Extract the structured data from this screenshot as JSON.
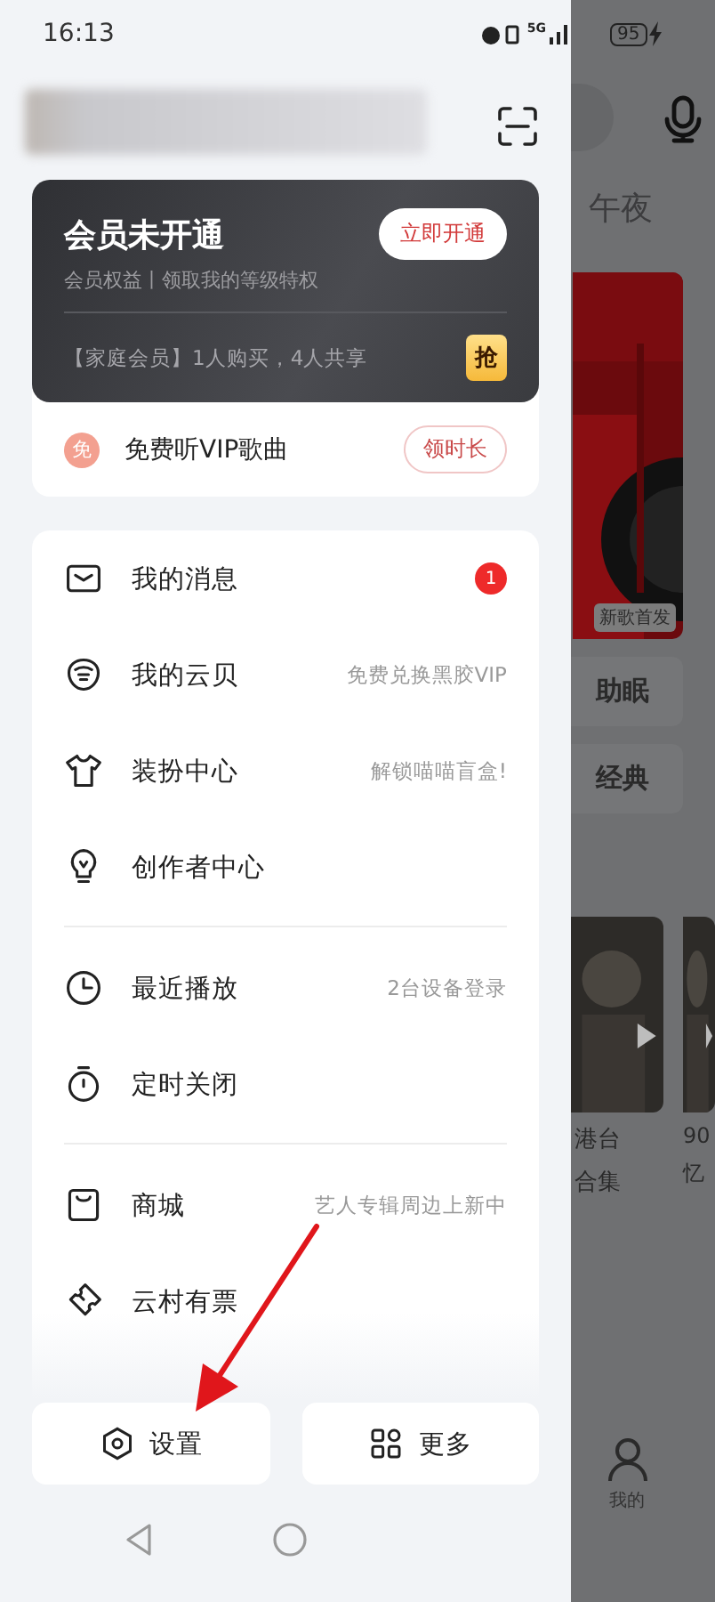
{
  "status_bar": {
    "time": "16:13",
    "network": "5G",
    "battery": "95"
  },
  "vip_card": {
    "title": "会员未开通",
    "button": "立即开通",
    "subtitle": "会员权益丨领取我的等级特权",
    "promo": "【家庭会员】1人购买，4人共享",
    "promo_tag": "抢"
  },
  "free_vip": {
    "badge": "免",
    "label": "免费听VIP歌曲",
    "button": "领时长"
  },
  "menu_groups": [
    [
      {
        "label": "我的消息",
        "badge": "1"
      },
      {
        "label": "我的云贝",
        "detail": "免费兑换黑胶VIP"
      },
      {
        "label": "装扮中心",
        "detail": "解锁喵喵盲盒!"
      },
      {
        "label": "创作者中心"
      }
    ],
    [
      {
        "label": "最近播放",
        "detail": "2台设备登录"
      },
      {
        "label": "定时关闭"
      }
    ],
    [
      {
        "label": "商城",
        "detail": "艺人专辑周边上新中"
      },
      {
        "label": "云村有票"
      }
    ]
  ],
  "bottom_buttons": [
    {
      "label": "设置"
    },
    {
      "label": "更多"
    }
  ],
  "background_app": {
    "tab": "午夜",
    "album_tag": "新歌首发",
    "chips": [
      "助眠",
      "经典"
    ],
    "captions": [
      [
        "港台",
        "合集"
      ],
      [
        "90",
        "忆"
      ]
    ],
    "nav_label": "我的"
  }
}
